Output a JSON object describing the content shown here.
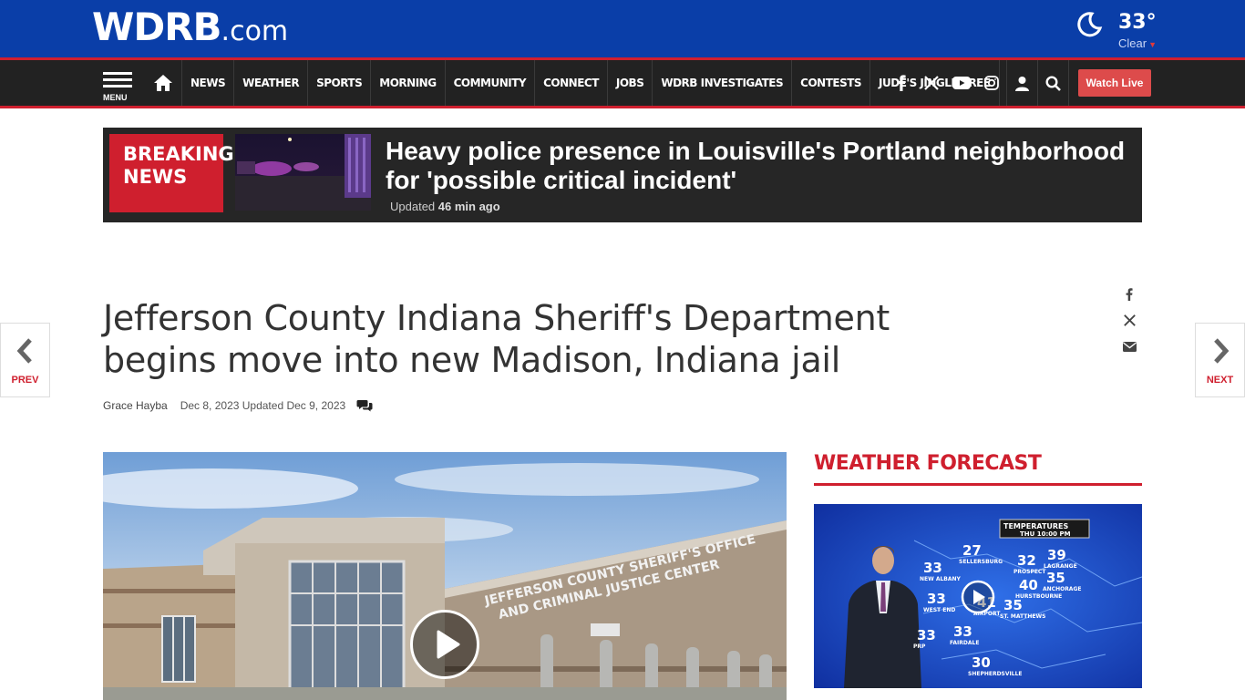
{
  "brand": {
    "logo_main": "WDRB",
    "logo_suffix": ".com"
  },
  "weather_widget": {
    "temperature": "33°",
    "condition": "Clear",
    "icon": "moon-icon"
  },
  "nav": {
    "menu_label": "MENU",
    "items": [
      "NEWS",
      "WEATHER",
      "SPORTS",
      "MORNING",
      "COMMUNITY",
      "CONNECT",
      "JOBS",
      "WDRB INVESTIGATES",
      "CONTESTS",
      "JUDE'S JINGLE TREE"
    ],
    "social_icons": [
      "facebook-icon",
      "x-icon",
      "youtube-icon",
      "instagram-icon"
    ],
    "watch_live": "Watch Live"
  },
  "breaking": {
    "label_line1": "BREAKING",
    "label_line2": "NEWS",
    "title": "Heavy police presence in Louisville's Portland neighborhood for 'possible critical incident'",
    "updated_prefix": "Updated",
    "updated_ago": "46 min ago"
  },
  "article": {
    "title": "Jefferson County Indiana Sheriff's Department begins move into new Madison, Indiana jail",
    "author": "Grace Hayba",
    "dates": "Dec 8, 2023 Updated Dec 9, 2023",
    "hero_sign": "JEFFERSON COUNTY SHERIFF'S OFFICE AND CRIMINAL JUSTICE CENTER"
  },
  "pager": {
    "prev": "PREV",
    "next": "NEXT"
  },
  "sidebar": {
    "weather_title": "WEATHER FORECAST",
    "map_header_line1": "TEMPERATURES",
    "map_header_line2": "THU 10:00 PM",
    "map_cities": [
      {
        "temp": "27",
        "name": "SELLERSBURG"
      },
      {
        "temp": "32",
        "name": "PROSPECT"
      },
      {
        "temp": "39",
        "name": "LAGRANGE"
      },
      {
        "temp": "33",
        "name": "NEW ALBANY"
      },
      {
        "temp": "40",
        "name": "HURSTBOURNE"
      },
      {
        "temp": "35",
        "name": "ANCHORAGE"
      },
      {
        "temp": "33",
        "name": "WEST END"
      },
      {
        "temp": "41",
        "name": "AIRPORT"
      },
      {
        "temp": "35",
        "name": "ST. MATTHEWS"
      },
      {
        "temp": "33",
        "name": "PRP"
      },
      {
        "temp": "33",
        "name": "FAIRDALE"
      },
      {
        "temp": "30",
        "name": "SHEPHERDSVILLE"
      }
    ]
  },
  "colors": {
    "brand_blue": "#0a3ea8",
    "accent_red": "#cf1f2e",
    "nav_bg": "#222222",
    "watch_btn": "#dd4b4b"
  }
}
